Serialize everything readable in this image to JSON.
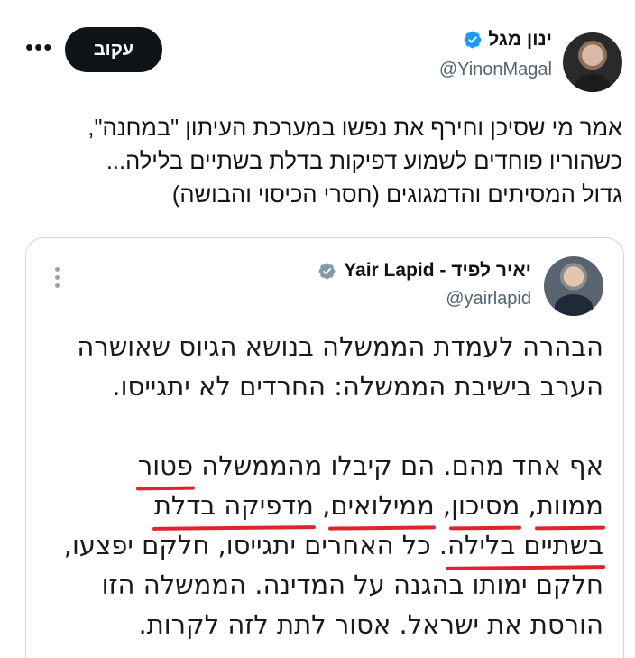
{
  "author": {
    "name": "ינון מגל",
    "handle": "@YinonMagal",
    "follow_label": "עקוב",
    "more_icon": "more-horizontal-icon"
  },
  "tweet": {
    "lines": [
      "אמר מי שסיכן וחירף את נפשו במערכת העיתון \"במחנה\",",
      "כשהוריו פוחדים לשמוע דפיקות בדלת בשתיים בלילה...",
      "גדול המסיתים והדמגוגים (חסרי הכיסוי והבושה)"
    ]
  },
  "quote": {
    "name": "יאיר לפיד - Yair Lapid",
    "handle": "@yairlapid",
    "para1": [
      "הבהרה לעמדת הממשלה בנושא הגיוס שאושרה",
      "הערב בישיבת הממשלה: החרדים לא יתגייסו."
    ],
    "line3_pre": "אף אחד מהם. הם קיבלו מהממשלה ",
    "line3_u": "פטור",
    "line4_u1": "ממוות",
    "line4_sep1": ", ",
    "line4_u2": "מסיכון",
    "line4_sep2": ", ",
    "line4_u3": "ממילואים",
    "line4_sep3": ", ",
    "line4_u4": "מדפיקה בדלת",
    "line5_u": "בשתיים בלילה",
    "line5_post": ". כל האחרים יתגייסו, חלקם יפצעו,",
    "line6": "חלקם ימותו בהגנה על המדינה. הממשלה הזו",
    "line7": "הורסת את ישראל. אסור לתת לזה לקרות."
  },
  "colors": {
    "verified_blue": "#1d9bf0",
    "verified_grey": "#829aab",
    "underline_red": "#e0242d"
  }
}
